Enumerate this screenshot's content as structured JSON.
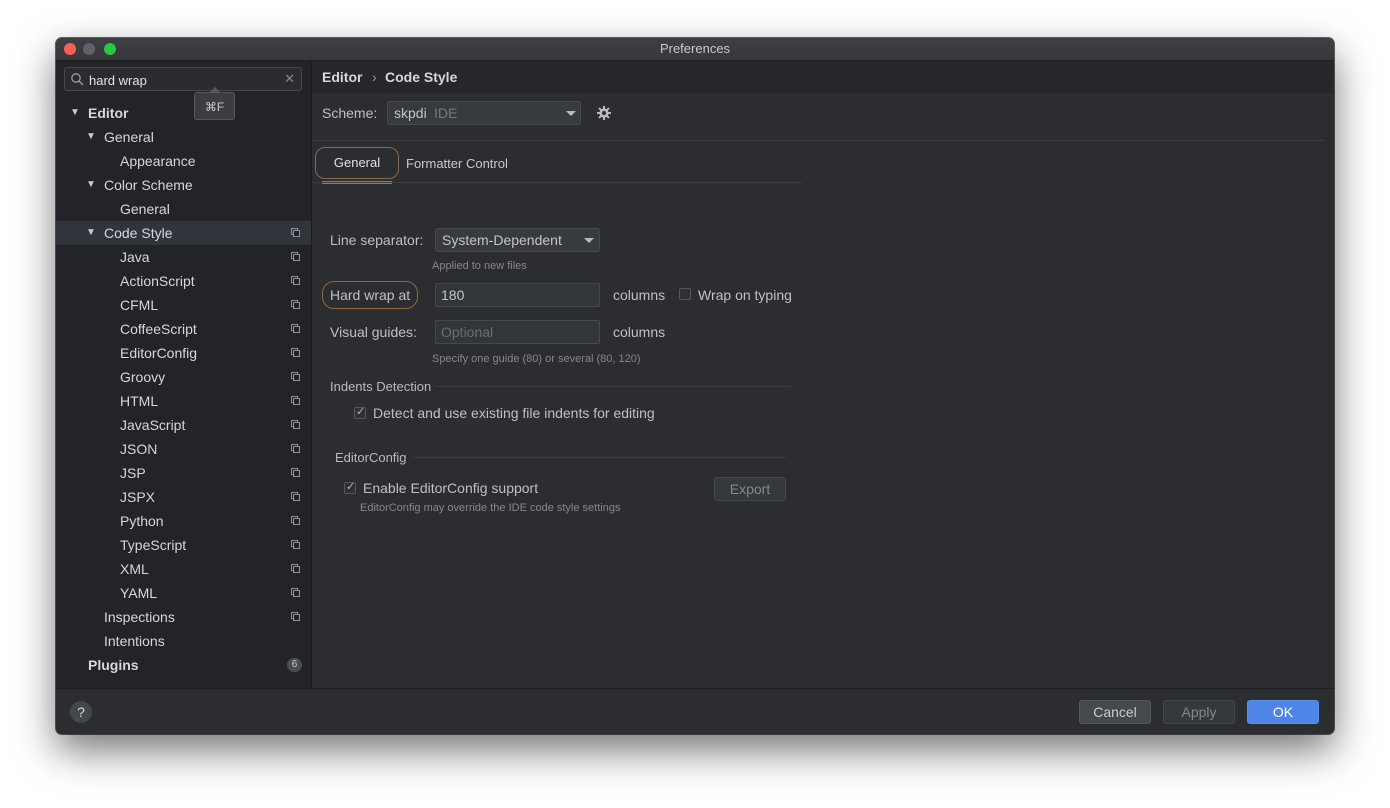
{
  "window": {
    "title": "Preferences"
  },
  "sidebar": {
    "search": {
      "value": "hard wrap",
      "placeholder": ""
    },
    "tooltip": "⌘F",
    "tree": [
      {
        "label": "Editor",
        "level": 0,
        "expanded": true,
        "bold": true
      },
      {
        "label": "General",
        "level": 1,
        "expanded": true
      },
      {
        "label": "Appearance",
        "level": 2
      },
      {
        "label": "Color Scheme",
        "level": 1,
        "expanded": true
      },
      {
        "label": "General",
        "level": 2
      },
      {
        "label": "Code Style",
        "level": 1,
        "expanded": true,
        "selected": true,
        "copy": true
      },
      {
        "label": "Java",
        "level": 2,
        "copy": true
      },
      {
        "label": "ActionScript",
        "level": 2,
        "copy": true
      },
      {
        "label": "CFML",
        "level": 2,
        "copy": true
      },
      {
        "label": "CoffeeScript",
        "level": 2,
        "copy": true
      },
      {
        "label": "EditorConfig",
        "level": 2,
        "copy": true
      },
      {
        "label": "Groovy",
        "level": 2,
        "copy": true
      },
      {
        "label": "HTML",
        "level": 2,
        "copy": true
      },
      {
        "label": "JavaScript",
        "level": 2,
        "copy": true
      },
      {
        "label": "JSON",
        "level": 2,
        "copy": true
      },
      {
        "label": "JSP",
        "level": 2,
        "copy": true
      },
      {
        "label": "JSPX",
        "level": 2,
        "copy": true
      },
      {
        "label": "Python",
        "level": 2,
        "copy": true
      },
      {
        "label": "TypeScript",
        "level": 2,
        "copy": true
      },
      {
        "label": "XML",
        "level": 2,
        "copy": true
      },
      {
        "label": "YAML",
        "level": 2,
        "copy": true
      },
      {
        "label": "Inspections",
        "level": 1,
        "copy": true
      },
      {
        "label": "Intentions",
        "level": 1
      },
      {
        "label": "Plugins",
        "level": 0,
        "bold": true,
        "badge": "6"
      }
    ]
  },
  "breadcrumb": {
    "parent": "Editor",
    "separator": "›",
    "current": "Code Style"
  },
  "scheme": {
    "label": "Scheme:",
    "name": "skpdi",
    "kind": "IDE"
  },
  "tabs": {
    "general": "General",
    "formatter": "Formatter Control"
  },
  "general": {
    "line_separator": {
      "label": "Line separator:",
      "value": "System-Dependent",
      "hint": "Applied to new files"
    },
    "hard_wrap": {
      "label": "Hard wrap at",
      "value": "180",
      "unit": "columns",
      "wrap_on_typing": "Wrap on typing",
      "wrap_on_typing_checked": false
    },
    "visual_guides": {
      "label": "Visual guides:",
      "placeholder": "Optional",
      "unit": "columns",
      "hint": "Specify one guide (80) or several (80, 120)"
    },
    "indents": {
      "title": "Indents Detection",
      "detect_label": "Detect and use existing file indents for editing",
      "checked": true
    },
    "editorconfig": {
      "title": "EditorConfig",
      "enable_label": "Enable EditorConfig support",
      "checked": true,
      "export": "Export",
      "hint": "EditorConfig may override the IDE code style settings"
    }
  },
  "footer": {
    "help": "?",
    "cancel": "Cancel",
    "apply": "Apply",
    "ok": "OK"
  },
  "colors": {
    "accent": "#4e86e8",
    "highlight_ring": "#8b6a3b",
    "window_bg": "#2b2d31",
    "sidebar_bg": "#222427"
  }
}
